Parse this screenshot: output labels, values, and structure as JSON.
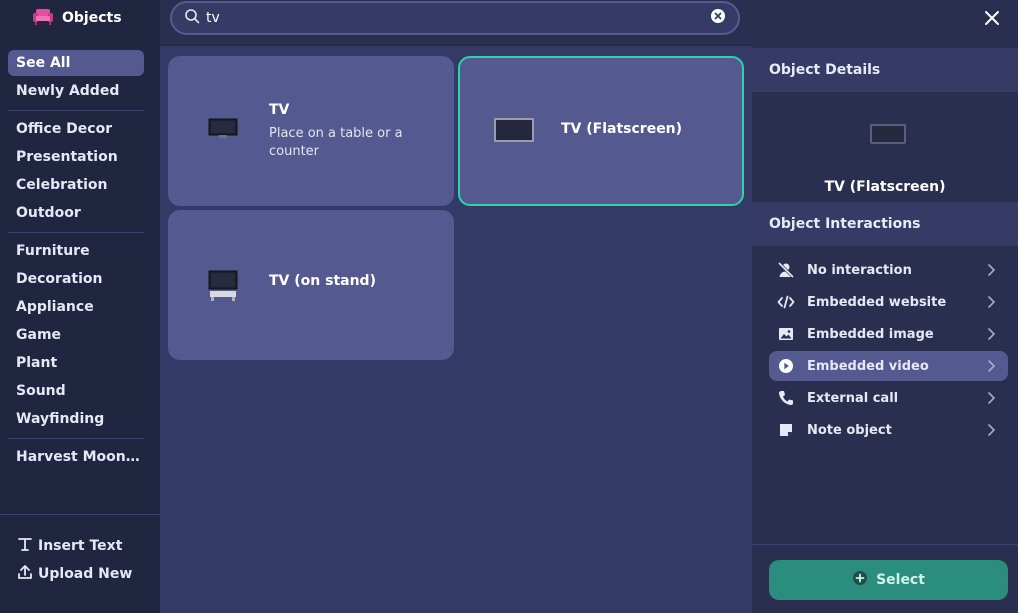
{
  "sidebar": {
    "title": "Objects",
    "items": [
      {
        "label": "See All",
        "active": true
      },
      {
        "label": "Newly Added"
      },
      {
        "label": "Office Decor"
      },
      {
        "label": "Presentation"
      },
      {
        "label": "Celebration"
      },
      {
        "label": "Outdoor"
      },
      {
        "label": "Furniture"
      },
      {
        "label": "Decoration"
      },
      {
        "label": "Appliance"
      },
      {
        "label": "Game"
      },
      {
        "label": "Plant"
      },
      {
        "label": "Sound"
      },
      {
        "label": "Wayfinding"
      },
      {
        "label": "Harvest Moon Fe..."
      }
    ],
    "actions": {
      "insert_text": "Insert Text",
      "upload_new": "Upload New"
    }
  },
  "search": {
    "value": "tv"
  },
  "results": [
    {
      "name": "TV",
      "description": "Place on a table or a counter"
    },
    {
      "name": "TV (Flatscreen)",
      "selected": true
    },
    {
      "name": "TV (on stand)"
    }
  ],
  "details": {
    "header": "Object Details",
    "object_name": "TV (Flatscreen)",
    "interactions_header": "Object Interactions",
    "interactions": [
      {
        "label": "No interaction",
        "icon": "no-interaction-icon"
      },
      {
        "label": "Embedded website",
        "icon": "code-icon"
      },
      {
        "label": "Embedded image",
        "icon": "image-icon"
      },
      {
        "label": "Embedded video",
        "icon": "play-icon",
        "active": true
      },
      {
        "label": "External call",
        "icon": "phone-icon"
      },
      {
        "label": "Note object",
        "icon": "note-icon"
      }
    ],
    "select_label": "Select"
  },
  "colors": {
    "accent": "#2fd1a8",
    "select_button": "#2a8d7d",
    "active_item": "#545a90"
  }
}
